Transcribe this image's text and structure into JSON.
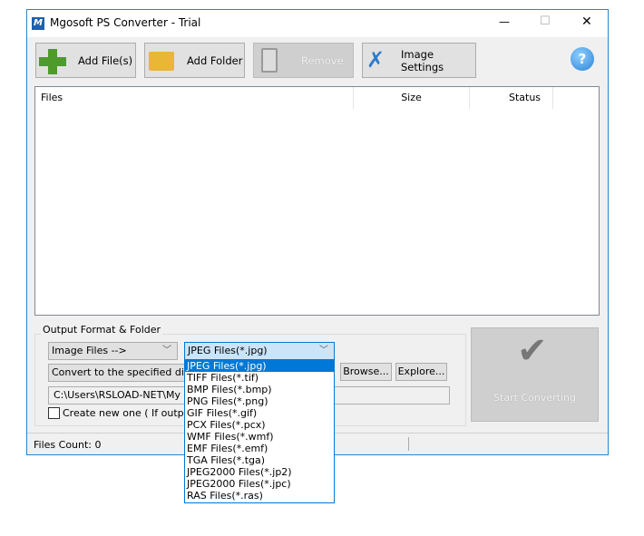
{
  "window": {
    "title": "Mgosoft PS Converter - Trial",
    "minimize": "—",
    "maximize": "☐",
    "close": "✕"
  },
  "toolbar": {
    "add_files": "Add File(s)",
    "add_folder": "Add Folder",
    "remove": "Remove",
    "image_settings": "Image Settings",
    "help": "?"
  },
  "file_list": {
    "columns": [
      "Files",
      "Size",
      "Status"
    ]
  },
  "output": {
    "group_label": "Output Format & Folder",
    "category": "Image Files -->",
    "format": "JPEG Files(*.jpg)",
    "mode": "Convert to the specified direct",
    "browse": "Browse...",
    "explore": "Explore...",
    "path": "C:\\Users\\RSLOAD-NET\\My Doc",
    "create_new": "Create new one ( If output f",
    "start": "Start Converting"
  },
  "format_options": [
    "JPEG Files(*.jpg)",
    "TIFF Files(*.tif)",
    "BMP Files(*.bmp)",
    "PNG Files(*.png)",
    "GIF Files(*.gif)",
    "PCX Files(*.pcx)",
    "WMF Files(*.wmf)",
    "EMF Files(*.emf)",
    "TGA Files(*.tga)",
    "JPEG2000 Files(*.jp2)",
    "JPEG2000 Files(*.jpc)",
    "RAS Files(*.ras)"
  ],
  "status": {
    "files_count": "Files Count: 0"
  }
}
